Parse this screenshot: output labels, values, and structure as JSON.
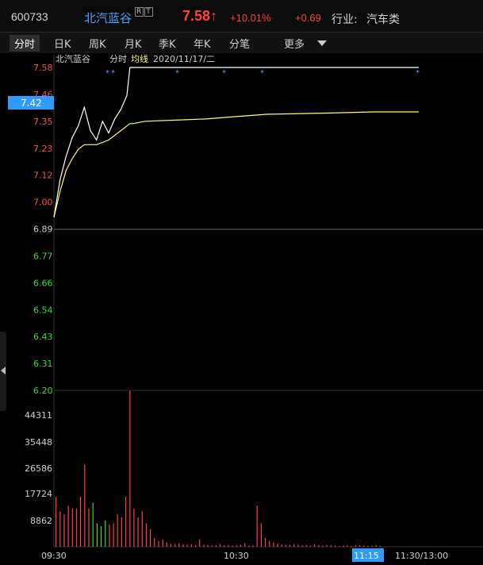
{
  "header": {
    "code": "600733",
    "name": "北汽蓝谷",
    "badge_r": "R",
    "badge_t": "T",
    "price": "7.58",
    "arrow": "↑",
    "pct": "+10.01%",
    "change": "+0.69",
    "industry_label": "行业:",
    "industry_value": "汽车类"
  },
  "tabs": [
    "分时",
    "日K",
    "周K",
    "月K",
    "季K",
    "年K",
    "分笔",
    "更多"
  ],
  "legend": {
    "name": "北汽蓝谷",
    "series1": "分时",
    "series2": "均线",
    "date": "2020/11/17/二"
  },
  "current_price_tag": "7.42",
  "colors": {
    "up": "#ff4040",
    "down": "#33dd33",
    "price_line": "#ffffff",
    "avg_line": "#ffff66",
    "accent": "#4aa3ff"
  },
  "chart_data": [
    {
      "type": "line",
      "title": "分时",
      "y_tick_labels": [
        "7.58",
        "7.46",
        "7.35",
        "7.23",
        "7.12",
        "7.00",
        "6.89",
        "6.77",
        "6.66",
        "6.54",
        "6.43",
        "6.31",
        "6.20"
      ],
      "ylim": [
        6.2,
        7.58
      ],
      "x_tick_labels": [
        "09:30",
        "10:30",
        "11:15",
        "11:30/13:00"
      ],
      "x": [
        "09:30",
        "09:32",
        "09:34",
        "09:36",
        "09:38",
        "09:40",
        "09:42",
        "09:44",
        "09:46",
        "09:48",
        "09:50",
        "09:52",
        "09:54",
        "09:55",
        "09:56",
        "10:00",
        "10:10",
        "10:20",
        "10:30",
        "10:40",
        "11:00",
        "11:15",
        "11:30"
      ],
      "series": [
        {
          "name": "分时",
          "values": [
            6.94,
            7.1,
            7.2,
            7.28,
            7.33,
            7.41,
            7.31,
            7.27,
            7.35,
            7.3,
            7.36,
            7.4,
            7.46,
            7.58,
            7.58,
            7.58,
            7.58,
            7.58,
            7.58,
            7.58,
            7.58,
            7.58,
            7.58
          ]
        },
        {
          "name": "均线",
          "values": [
            6.94,
            7.05,
            7.14,
            7.19,
            7.23,
            7.25,
            7.25,
            7.25,
            7.26,
            7.27,
            7.29,
            7.31,
            7.33,
            7.34,
            7.34,
            7.35,
            7.355,
            7.36,
            7.37,
            7.38,
            7.385,
            7.39,
            7.39
          ]
        }
      ],
      "grid": false
    },
    {
      "type": "bar",
      "title": "成交量",
      "y_tick_labels": [
        "44311",
        "35448",
        "26586",
        "17724",
        "8862"
      ],
      "ylim": [
        0,
        53173
      ],
      "x_tick_labels": [
        "09:30",
        "10:30",
        "11:15",
        "11:30/13:00"
      ],
      "values": [
        17000,
        12000,
        11000,
        14000,
        13000,
        13000,
        17000,
        28000,
        13000,
        15000,
        8000,
        7000,
        9000,
        7500,
        8000,
        11000,
        10000,
        17000,
        53000,
        13000,
        10000,
        12000,
        8000,
        6000,
        3000,
        2000,
        2500,
        1500,
        1000,
        900,
        1200,
        800,
        700,
        900,
        600,
        2500,
        700,
        600,
        500,
        500,
        900,
        500,
        600,
        400,
        500,
        700,
        1200,
        400,
        500,
        14000,
        8000,
        3000,
        2000,
        1500,
        1000,
        800,
        700,
        600,
        900,
        700,
        500,
        600,
        400,
        800,
        500,
        400,
        600,
        500,
        400,
        300,
        400,
        500,
        300,
        600,
        500,
        400,
        300,
        400,
        500,
        300
      ],
      "colors_down_idx": [
        9,
        10,
        11,
        12
      ]
    }
  ]
}
